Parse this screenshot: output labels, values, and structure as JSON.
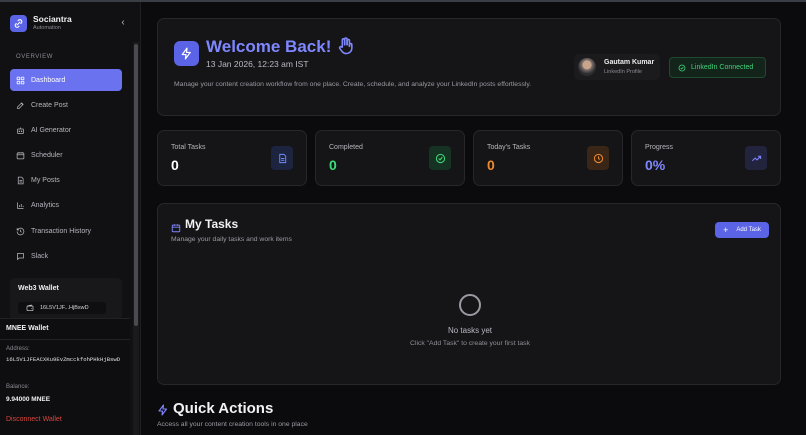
{
  "brand": {
    "name": "Sociantra",
    "subtitle": "Automation",
    "logo_icon": "link-icon"
  },
  "sidebar": {
    "section_label": "OVERVIEW",
    "items": [
      {
        "label": "Dashboard",
        "icon": "grid-icon",
        "active": true
      },
      {
        "label": "Create Post",
        "icon": "edit-icon"
      },
      {
        "label": "AI Generator",
        "icon": "bot-icon"
      },
      {
        "label": "Scheduler",
        "icon": "calendar-icon"
      },
      {
        "label": "My Posts",
        "icon": "document-icon"
      },
      {
        "label": "Analytics",
        "icon": "bar-chart-icon"
      },
      {
        "label": "Transaction History",
        "icon": "history-icon"
      },
      {
        "label": "Slack",
        "icon": "chat-icon"
      }
    ],
    "wallet": {
      "title": "Web3 Wallet",
      "address_short": "16L5V1JF...HjBswD"
    }
  },
  "mnee": {
    "title": "MNEE Wallet",
    "address_label": "Address:",
    "address": "16L5V1JFEACXKu9EvZmcckfohPHkHjBswD",
    "balance_label": "Balance:",
    "balance": "9.94000 MNEE",
    "disconnect": "Disconnect Wallet"
  },
  "welcome": {
    "title": "Welcome Back!",
    "wave": "👋",
    "date": "13 Jan 2026, 12:23 am IST",
    "description": "Manage your content creation workflow from one place. Create, schedule, and analyze your LinkedIn posts effortlessly.",
    "profile_name": "Gautam Kumar",
    "profile_sub": "LinkedIn Profile",
    "linkedin_status": "LinkedIn Connected"
  },
  "stats": [
    {
      "label": "Total Tasks",
      "value": "0",
      "color": "#ffffff",
      "icon": "document-icon",
      "icon_bg": "#1c2440",
      "icon_color": "#6f8cff"
    },
    {
      "label": "Completed",
      "value": "0",
      "color": "#3ddc7a",
      "icon": "check-circle-icon",
      "icon_bg": "#163222",
      "icon_color": "#3ddc7a"
    },
    {
      "label": "Today's Tasks",
      "value": "0",
      "color": "#f08a2e",
      "icon": "clock-icon",
      "icon_bg": "#3a2616",
      "icon_color": "#f08a2e"
    },
    {
      "label": "Progress",
      "value": "0%",
      "color": "#7f87ff",
      "icon": "trending-up-icon",
      "icon_bg": "#22243d",
      "icon_color": "#7f87ff"
    }
  ],
  "tasks": {
    "title": "My Tasks",
    "subtitle": "Manage your daily tasks and work items",
    "add_label": "Add Task",
    "empty_title": "No tasks yet",
    "empty_sub": "Click \"Add Task\" to create your first task"
  },
  "quick_actions": {
    "title": "Quick Actions",
    "subtitle": "Access all your content creation tools in one place"
  }
}
